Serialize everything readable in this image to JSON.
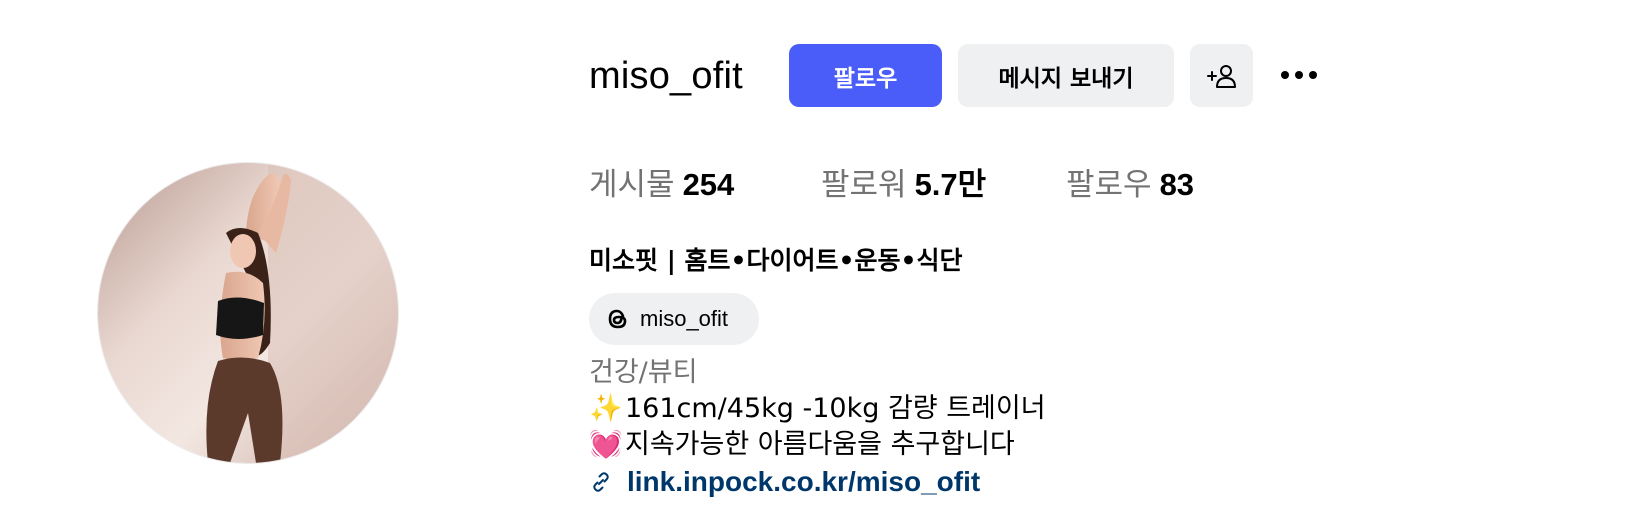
{
  "profile": {
    "username": "miso_ofit",
    "follow_label": "팔로우",
    "message_label": "메시지 보내기",
    "suggest_icon": "person-add-icon",
    "more_icon": "more-horizontal-icon"
  },
  "stats": {
    "posts_label": "게시물",
    "posts_value": "254",
    "followers_label": "팔로워",
    "followers_value": "5.7만",
    "following_label": "팔로우",
    "following_value": "83"
  },
  "bio": {
    "display_name": "미소핏 | 홈트•다이어트•운동•식단",
    "threads_handle": "miso_ofit",
    "category": "건강/뷰티",
    "line1_emoji": "✨",
    "line1_text": "161cm/45kg -10kg 감량 트레이너",
    "line2_emoji": "💓",
    "line2_text": "지속가능한 아름다움을 추구합니다",
    "link_text": "link.inpock.co.kr/miso_ofit"
  },
  "colors": {
    "primary_button": "#4a5df9",
    "secondary_button": "#eff0f2",
    "muted_text": "#737373",
    "link": "#00376b"
  }
}
